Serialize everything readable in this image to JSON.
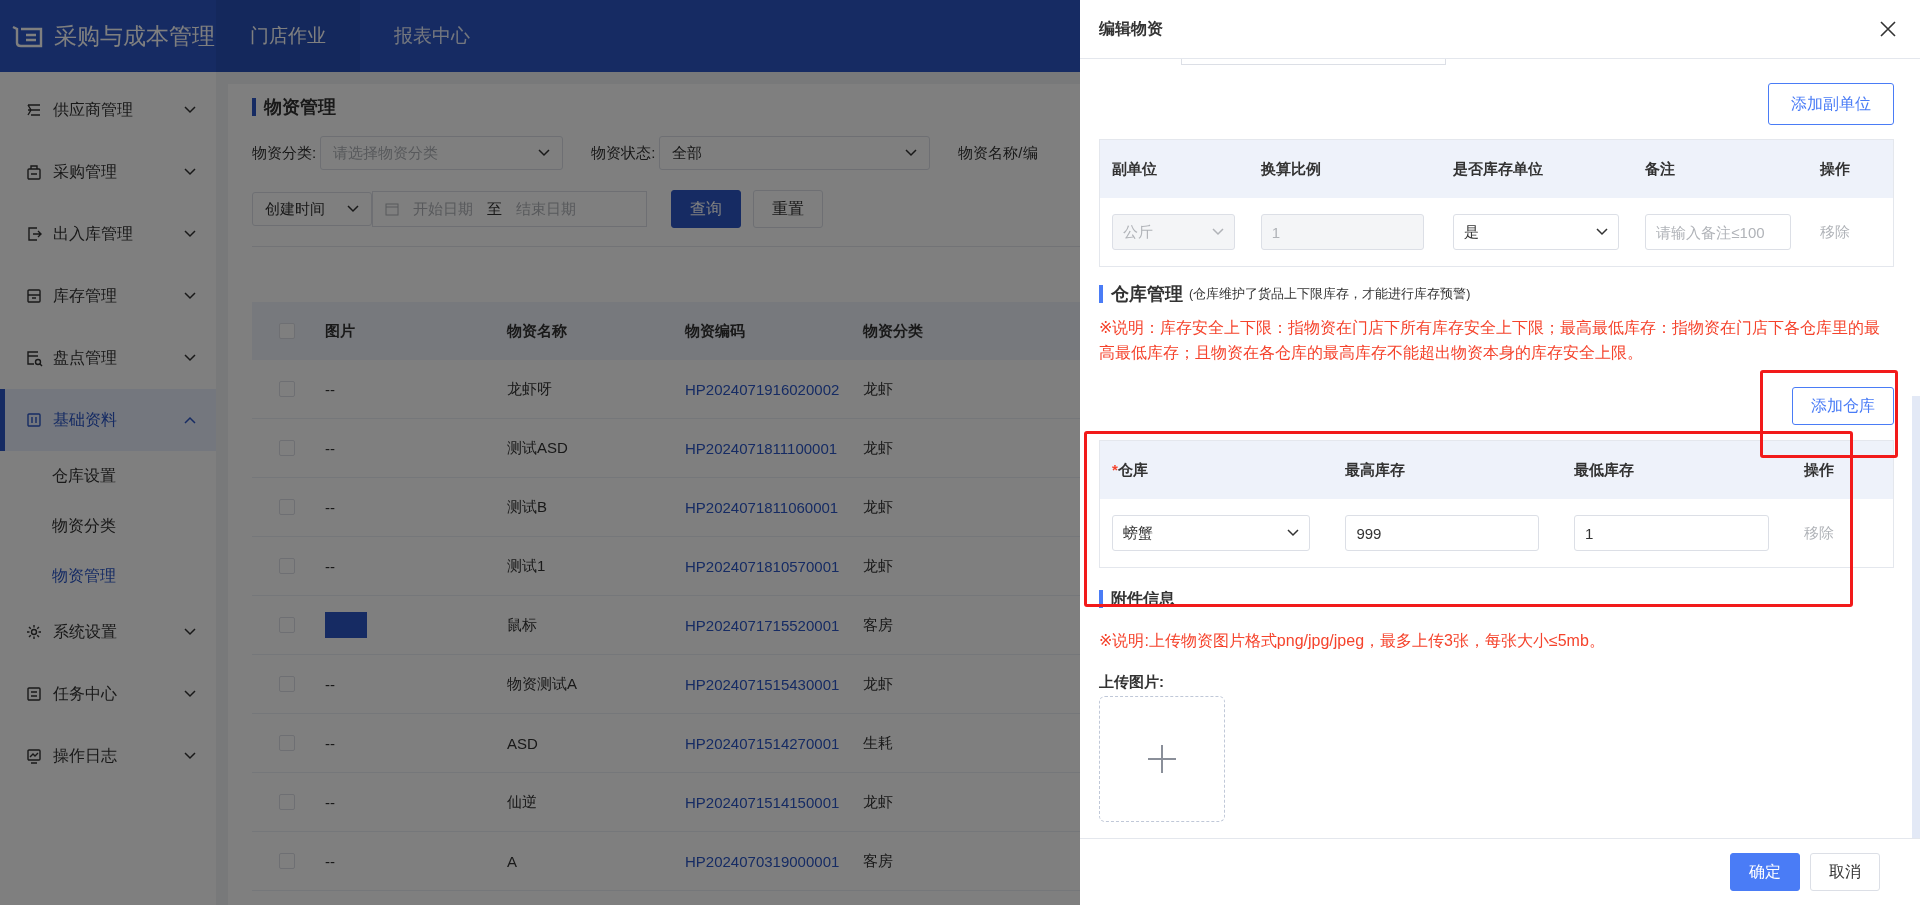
{
  "header": {
    "logo_text": "采购与成本管理",
    "tabs": [
      {
        "label": "门店作业",
        "selected": true
      },
      {
        "label": "报表中心",
        "selected": false
      }
    ]
  },
  "sidebar": {
    "items": [
      {
        "label": "供应商管理",
        "expanded": false,
        "selected": false
      },
      {
        "label": "采购管理",
        "expanded": false,
        "selected": false
      },
      {
        "label": "出入库管理",
        "expanded": false,
        "selected": false
      },
      {
        "label": "库存管理",
        "expanded": false,
        "selected": false
      },
      {
        "label": "盘点管理",
        "expanded": false,
        "selected": false
      },
      {
        "label": "基础资料",
        "expanded": true,
        "selected": true,
        "children": [
          {
            "label": "仓库设置",
            "selected": false
          },
          {
            "label": "物资分类",
            "selected": false
          },
          {
            "label": "物资管理",
            "selected": true
          }
        ]
      },
      {
        "label": "系统设置",
        "expanded": false,
        "selected": false
      },
      {
        "label": "任务中心",
        "expanded": false,
        "selected": false
      },
      {
        "label": "操作日志",
        "expanded": false,
        "selected": false
      }
    ]
  },
  "page": {
    "title": "物资管理",
    "filters": [
      {
        "label": "物资分类:",
        "placeholder": "请选择物资分类"
      },
      {
        "label": "物资状态:",
        "value": "全部"
      },
      {
        "label": "物资名称/编"
      }
    ],
    "date_filter": {
      "type": "创建时间",
      "start_placeholder": "开始日期",
      "separator": "至",
      "end_placeholder": "结束日期"
    },
    "buttons": [
      {
        "label": "查询",
        "kind": "primary"
      },
      {
        "label": "重置",
        "kind": "default"
      }
    ],
    "table": {
      "select_all": {
        "checked": false
      },
      "columns": [
        "图片",
        "物资名称",
        "物资编码",
        "物资分类"
      ],
      "rows": [
        {
          "checked": false,
          "image": "--",
          "name": "龙虾呀",
          "code": "HP2024071916020002",
          "category": "龙虾"
        },
        {
          "checked": false,
          "image": "--",
          "name": "测试ASD",
          "code": "HP2024071811100001",
          "category": "龙虾"
        },
        {
          "checked": false,
          "image": "--",
          "name": "测试B",
          "code": "HP2024071811060001",
          "category": "龙虾"
        },
        {
          "checked": false,
          "image": "--",
          "name": "测试1",
          "code": "HP2024071810570001",
          "category": "龙虾"
        },
        {
          "checked": false,
          "has_photo": true,
          "name": "鼠标",
          "code": "HP2024071715520001",
          "category": "客房"
        },
        {
          "checked": false,
          "image": "--",
          "name": "物资测试A",
          "code": "HP2024071515430001",
          "category": "龙虾"
        },
        {
          "checked": false,
          "image": "--",
          "name": "ASD",
          "code": "HP2024071514270001",
          "category": "生耗"
        },
        {
          "checked": false,
          "image": "--",
          "name": "仙逆",
          "code": "HP2024071514150001",
          "category": "龙虾"
        },
        {
          "checked": false,
          "image": "--",
          "name": "A",
          "code": "HP2024070319000001",
          "category": "客房"
        }
      ]
    }
  },
  "drawer": {
    "title": "编辑物资",
    "sub_units": {
      "add_button": "添加副单位",
      "columns": [
        "副单位",
        "换算比例",
        "是否库存单位",
        "备注",
        "操作"
      ],
      "rows": [
        {
          "unit": "公斤",
          "unit_disabled": true,
          "ratio": "1",
          "ratio_disabled": true,
          "stock_unit": "是",
          "remark_placeholder": "请输入备注≤100",
          "action": "移除",
          "action_disabled": true
        }
      ]
    },
    "warehouse": {
      "title": "仓库管理",
      "hint": "(仓库维护了货品上下限库存，才能进行库存预警)",
      "note": "※说明：库存安全上下限：指物资在门店下所有库存安全上下限；最高最低库存：指物资在门店下各仓库里的最高最低库存；且物资在各仓库的最高库存不能超出物资本身的库存安全上限。",
      "add_button": "添加仓库",
      "required_mark": "*",
      "columns": [
        {
          "label": "仓库",
          "required": true
        },
        {
          "label": "最高库存",
          "required": false
        },
        {
          "label": "最低库存",
          "required": false
        },
        {
          "label": "操作",
          "required": false
        }
      ],
      "rows": [
        {
          "warehouse": "螃蟹",
          "max": "999",
          "min": "1",
          "action": "移除",
          "action_disabled": true
        }
      ]
    },
    "attachments": {
      "title": "附件信息",
      "note": "※说明:上传物资图片格式png/jpg/jpeg，最多上传3张，每张大小≤5mb。",
      "upload_label": "上传图片:"
    },
    "footer_buttons": [
      {
        "label": "确定",
        "kind": "primary"
      },
      {
        "label": "取消",
        "kind": "default"
      }
    ]
  }
}
